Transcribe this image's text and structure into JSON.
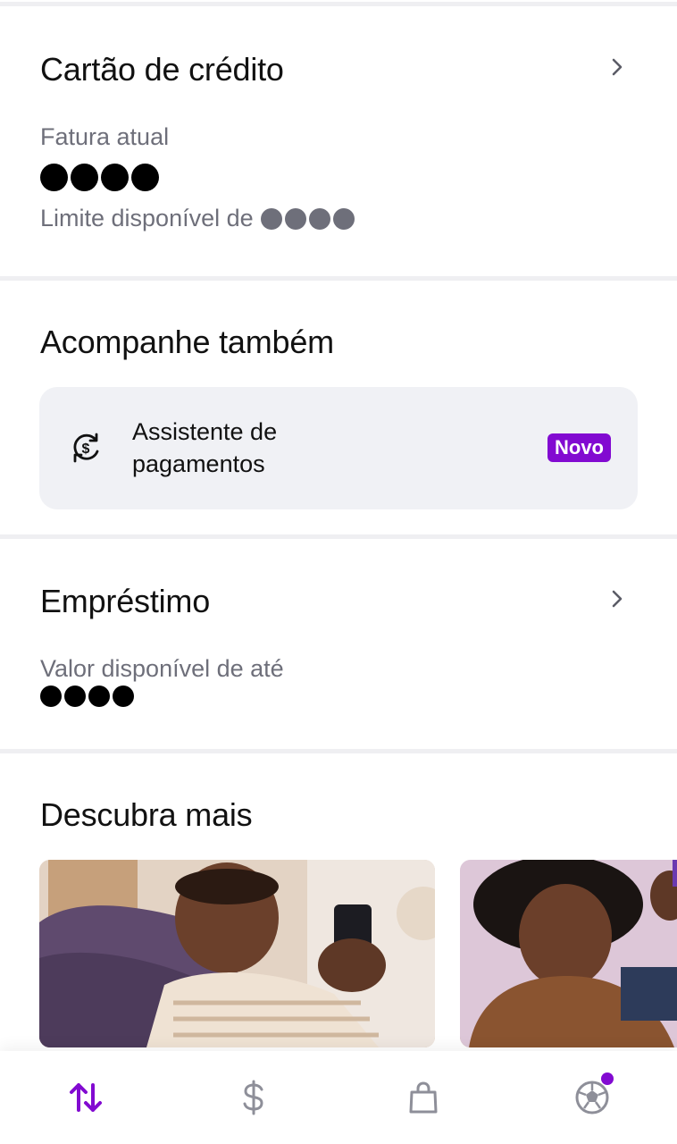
{
  "credit_card": {
    "title": "Cartão de crédito",
    "bill_label": "Fatura atual",
    "limit_label": "Limite disponível de"
  },
  "also_follow": {
    "title": "Acompanhe também",
    "assistant": {
      "line1": "Assistente de",
      "line2": "pagamentos",
      "badge": "Novo"
    }
  },
  "loan": {
    "title": "Empréstimo",
    "available_label": "Valor disponível de até"
  },
  "discover": {
    "title": "Descubra mais"
  },
  "bottom_nav": {
    "items": [
      {
        "icon": "transfer-arrows-icon"
      },
      {
        "icon": "dollar-icon"
      },
      {
        "icon": "shopping-bag-icon"
      },
      {
        "icon": "soccer-ball-icon"
      }
    ]
  },
  "colors": {
    "accent": "#820ad1",
    "muted_text": "#6e6f7a",
    "card_bg": "#f0f1f5",
    "divider": "#efeff2"
  }
}
